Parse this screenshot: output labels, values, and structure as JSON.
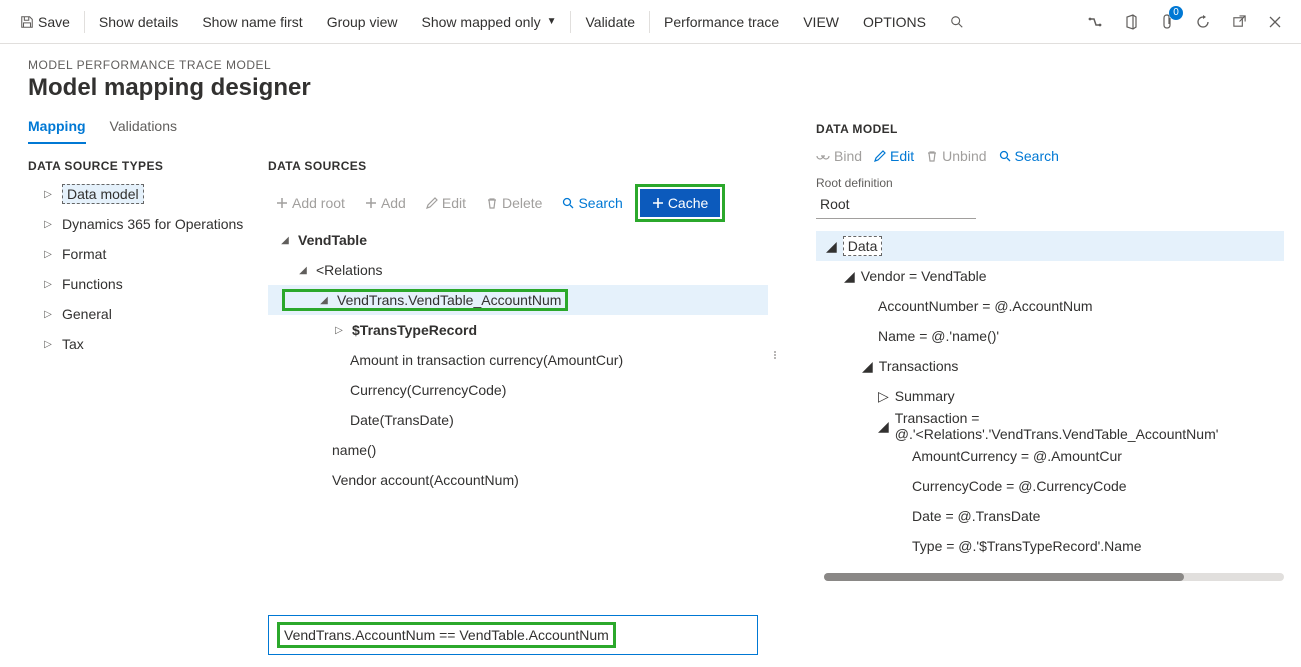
{
  "toolbar": {
    "save": "Save",
    "show_details": "Show details",
    "show_name_first": "Show name first",
    "group_view": "Group view",
    "show_mapped_only": "Show mapped only",
    "validate": "Validate",
    "perf_trace": "Performance trace",
    "view": "VIEW",
    "options": "OPTIONS",
    "notif_count": "0"
  },
  "breadcrumb": "MODEL PERFORMANCE TRACE MODEL",
  "page_title": "Model mapping designer",
  "tabs": {
    "mapping": "Mapping",
    "validations": "Validations"
  },
  "types": {
    "label": "DATA SOURCE TYPES",
    "items": [
      "Data model",
      "Dynamics 365 for Operations",
      "Format",
      "Functions",
      "General",
      "Tax"
    ]
  },
  "sources": {
    "label": "DATA SOURCES",
    "btn_add_root": "Add root",
    "btn_add": "Add",
    "btn_edit": "Edit",
    "btn_delete": "Delete",
    "btn_search": "Search",
    "btn_cache": "Cache",
    "tree": {
      "n0": "VendTable",
      "n1": "<Relations",
      "n2": "VendTrans.VendTable_AccountNum",
      "n3": "$TransTypeRecord",
      "n4": "Amount in transaction currency(AmountCur)",
      "n5": "Currency(CurrencyCode)",
      "n6": "Date(TransDate)",
      "n7": "name()",
      "n8": "Vendor account(AccountNum)"
    },
    "formula": "VendTrans.AccountNum == VendTable.AccountNum"
  },
  "model": {
    "label": "DATA MODEL",
    "btn_bind": "Bind",
    "btn_edit": "Edit",
    "btn_unbind": "Unbind",
    "btn_search": "Search",
    "root_label": "Root definition",
    "root_value": "Root",
    "tree": {
      "m0": "Data",
      "m1": "Vendor = VendTable",
      "m2": "AccountNumber = @.AccountNum",
      "m3": "Name = @.'name()'",
      "m4": "Transactions",
      "m5": "Summary",
      "m6": "Transaction = @.'<Relations'.'VendTrans.VendTable_AccountNum'",
      "m7": "AmountCurrency = @.AmountCur",
      "m8": "CurrencyCode = @.CurrencyCode",
      "m9": "Date = @.TransDate",
      "m10": "Type = @.'$TransTypeRecord'.Name"
    }
  }
}
